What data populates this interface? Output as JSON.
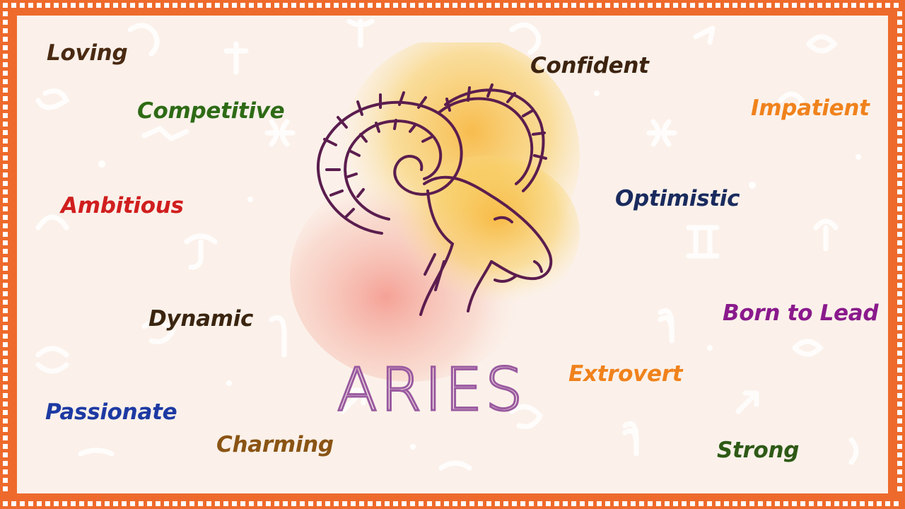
{
  "sign": {
    "name": "ARIES",
    "symbol": "ram-head-icon"
  },
  "traits": [
    {
      "key": "loving",
      "label": "Loving",
      "color": "#4a2a12"
    },
    {
      "key": "competitive",
      "label": "Competitive",
      "color": "#2e6b16"
    },
    {
      "key": "ambitious",
      "label": "Ambitious",
      "color": "#d01e1e"
    },
    {
      "key": "dynamic",
      "label": "Dynamic",
      "color": "#3b2510"
    },
    {
      "key": "passionate",
      "label": "Passionate",
      "color": "#1d3aa3"
    },
    {
      "key": "charming",
      "label": "Charming",
      "color": "#8a5414"
    },
    {
      "key": "confident",
      "label": "Confident",
      "color": "#3d2410"
    },
    {
      "key": "impatient",
      "label": "Impatient",
      "color": "#f0821c"
    },
    {
      "key": "optimistic",
      "label": "Optimistic",
      "color": "#1a2b5e"
    },
    {
      "key": "born_to_lead",
      "label": "Born to Lead",
      "color": "#8a1a8c"
    },
    {
      "key": "extrovert",
      "label": "Extrovert",
      "color": "#f0821c"
    },
    {
      "key": "strong",
      "label": "Strong",
      "color": "#2e5a16"
    }
  ],
  "colors": {
    "frame": "#ee6a2c",
    "paper": "#fbf1ea",
    "ram_line": "#5b1d4e",
    "aries_text": "#9a5aa0",
    "watercolor_warm": "#f6c24a",
    "watercolor_pink": "#f19a86"
  }
}
